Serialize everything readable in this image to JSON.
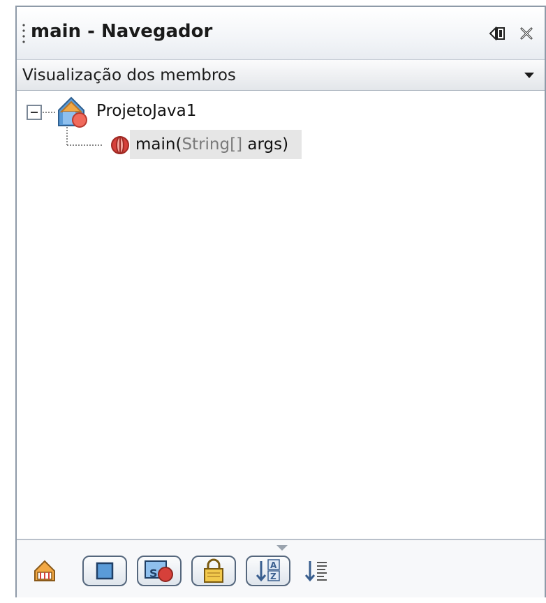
{
  "window": {
    "title": "main - Navegador",
    "minimize_icon": "minimize-window-icon",
    "close_icon": "close-icon"
  },
  "view_selector": {
    "selected": "Visualização dos membros",
    "arrow_icon": "dropdown-arrow-icon"
  },
  "tree": {
    "root": {
      "label": "ProjetoJava1",
      "icon": "java-class-icon",
      "expanded": true,
      "children": [
        {
          "method_name": "main(",
          "params": "String[]",
          "tail": " args)",
          "icon": "method-icon",
          "selected": true
        }
      ]
    }
  },
  "toolbar": {
    "buttons": [
      {
        "name": "show-inherited-members-button",
        "icon": "inherited-members-icon",
        "pressed": false
      },
      {
        "name": "show-fields-button",
        "icon": "fields-icon",
        "pressed": true
      },
      {
        "name": "show-static-members-button",
        "icon": "static-members-icon",
        "pressed": true
      },
      {
        "name": "show-non-public-members-button",
        "icon": "lock-icon",
        "pressed": true
      },
      {
        "name": "sort-by-name-button",
        "icon": "sort-alphabetically-icon",
        "pressed": true
      },
      {
        "name": "sort-by-source-button",
        "icon": "sort-by-source-icon",
        "pressed": false
      }
    ]
  },
  "colors": {
    "panel_border": "#8e9aa8",
    "selection": "#e6e6e6",
    "button_border": "#55677d",
    "method_red": "#d6403a",
    "class_orange": "#f2a844",
    "class_blue": "#5a9bd8"
  }
}
